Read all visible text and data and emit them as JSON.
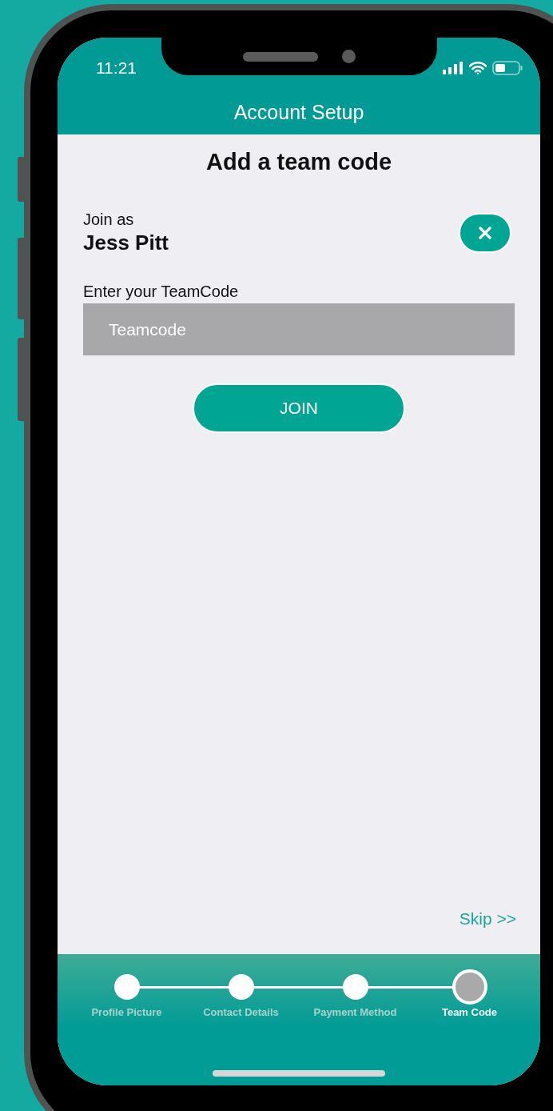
{
  "status_bar": {
    "time": "11:21"
  },
  "header": {
    "title": "Account Setup"
  },
  "heading": "Add a team code",
  "join": {
    "label": "Join as",
    "name": "Jess Pitt"
  },
  "team_code_field": {
    "label": "Enter your TeamCode",
    "placeholder": "Teamcode"
  },
  "join_button": "JOIN",
  "skip_link": "Skip >>",
  "steps": [
    {
      "label": "Profile Picture",
      "selected": false
    },
    {
      "label": "Contact Details",
      "selected": false
    },
    {
      "label": "Payment Method",
      "selected": false
    },
    {
      "label": "Team Code",
      "selected": true
    }
  ]
}
